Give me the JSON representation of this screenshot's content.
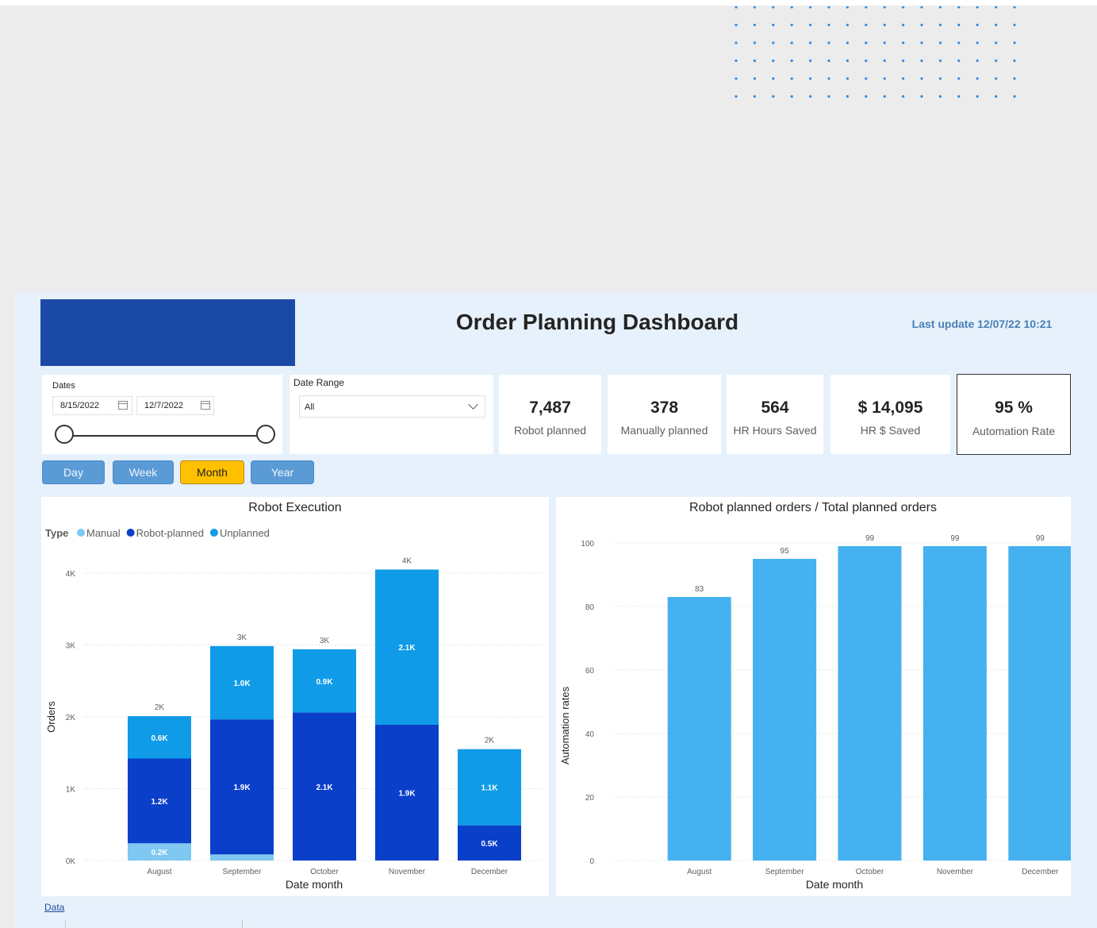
{
  "header": {
    "title": "Order Planning Dashboard",
    "last_update": "Last update 12/07/22 10:21"
  },
  "filters": {
    "dates_label": "Dates",
    "start_date": "8/15/2022",
    "end_date": "12/7/2022",
    "date_range_label": "Date Range",
    "date_range_value": "All"
  },
  "kpis": [
    {
      "value": "7,487",
      "label": "Robot planned"
    },
    {
      "value": "378",
      "label": "Manually planned"
    },
    {
      "value": "564",
      "label": "HR Hours Saved"
    },
    {
      "value": "$ 14,095",
      "label": "HR $ Saved"
    },
    {
      "value": "95 %",
      "label": "Automation Rate"
    }
  ],
  "granularity_buttons": [
    {
      "label": "Day",
      "active": false
    },
    {
      "label": "Week",
      "active": false
    },
    {
      "label": "Month",
      "active": true
    },
    {
      "label": "Year",
      "active": false
    }
  ],
  "footer": {
    "data_link": "Data"
  },
  "colors": {
    "manual": "#7ec8f2",
    "robot_planned": "#0a3fc9",
    "unplanned": "#0f9be8",
    "rate_bar": "#45b1f0",
    "active_button": "#ffc000",
    "button": "#5b9bd5"
  },
  "chart_data": [
    {
      "type": "bar",
      "stacked": true,
      "title": "Robot Execution",
      "legend_title": "Type",
      "legend_position": "top-left",
      "xlabel": "Date month",
      "ylabel": "Orders",
      "categories": [
        "August",
        "September",
        "October",
        "November",
        "December"
      ],
      "ylim": [
        0,
        4000
      ],
      "yticks": [
        0,
        1000,
        2000,
        3000,
        4000
      ],
      "ytick_labels": [
        "0K",
        "1K",
        "2K",
        "3K",
        "4K"
      ],
      "grid": true,
      "series": [
        {
          "name": "Manual",
          "values": [
            240,
            85,
            0,
            0,
            0
          ],
          "labels": [
            "0.2K",
            "",
            "",
            "",
            ""
          ]
        },
        {
          "name": "Robot-planned",
          "values": [
            1180,
            1880,
            2060,
            1890,
            490
          ],
          "labels": [
            "1.2K",
            "1.9K",
            "2.1K",
            "1.9K",
            "0.5K"
          ]
        },
        {
          "name": "Unplanned",
          "values": [
            590,
            1020,
            880,
            2160,
            1060
          ],
          "labels": [
            "0.6K",
            "1.0K",
            "0.9K",
            "2.1K",
            "1.1K"
          ]
        }
      ],
      "total_labels": [
        "2K",
        "3K",
        "3K",
        "4K",
        "2K"
      ]
    },
    {
      "type": "bar",
      "title": "Robot planned orders / Total planned orders",
      "xlabel": "Date month",
      "ylabel": "Automation rates",
      "categories": [
        "August",
        "September",
        "October",
        "November",
        "December"
      ],
      "values": [
        83,
        95,
        99,
        99,
        99
      ],
      "ylim": [
        0,
        100
      ],
      "yticks": [
        0,
        20,
        40,
        60,
        80,
        100
      ],
      "grid": true
    }
  ]
}
